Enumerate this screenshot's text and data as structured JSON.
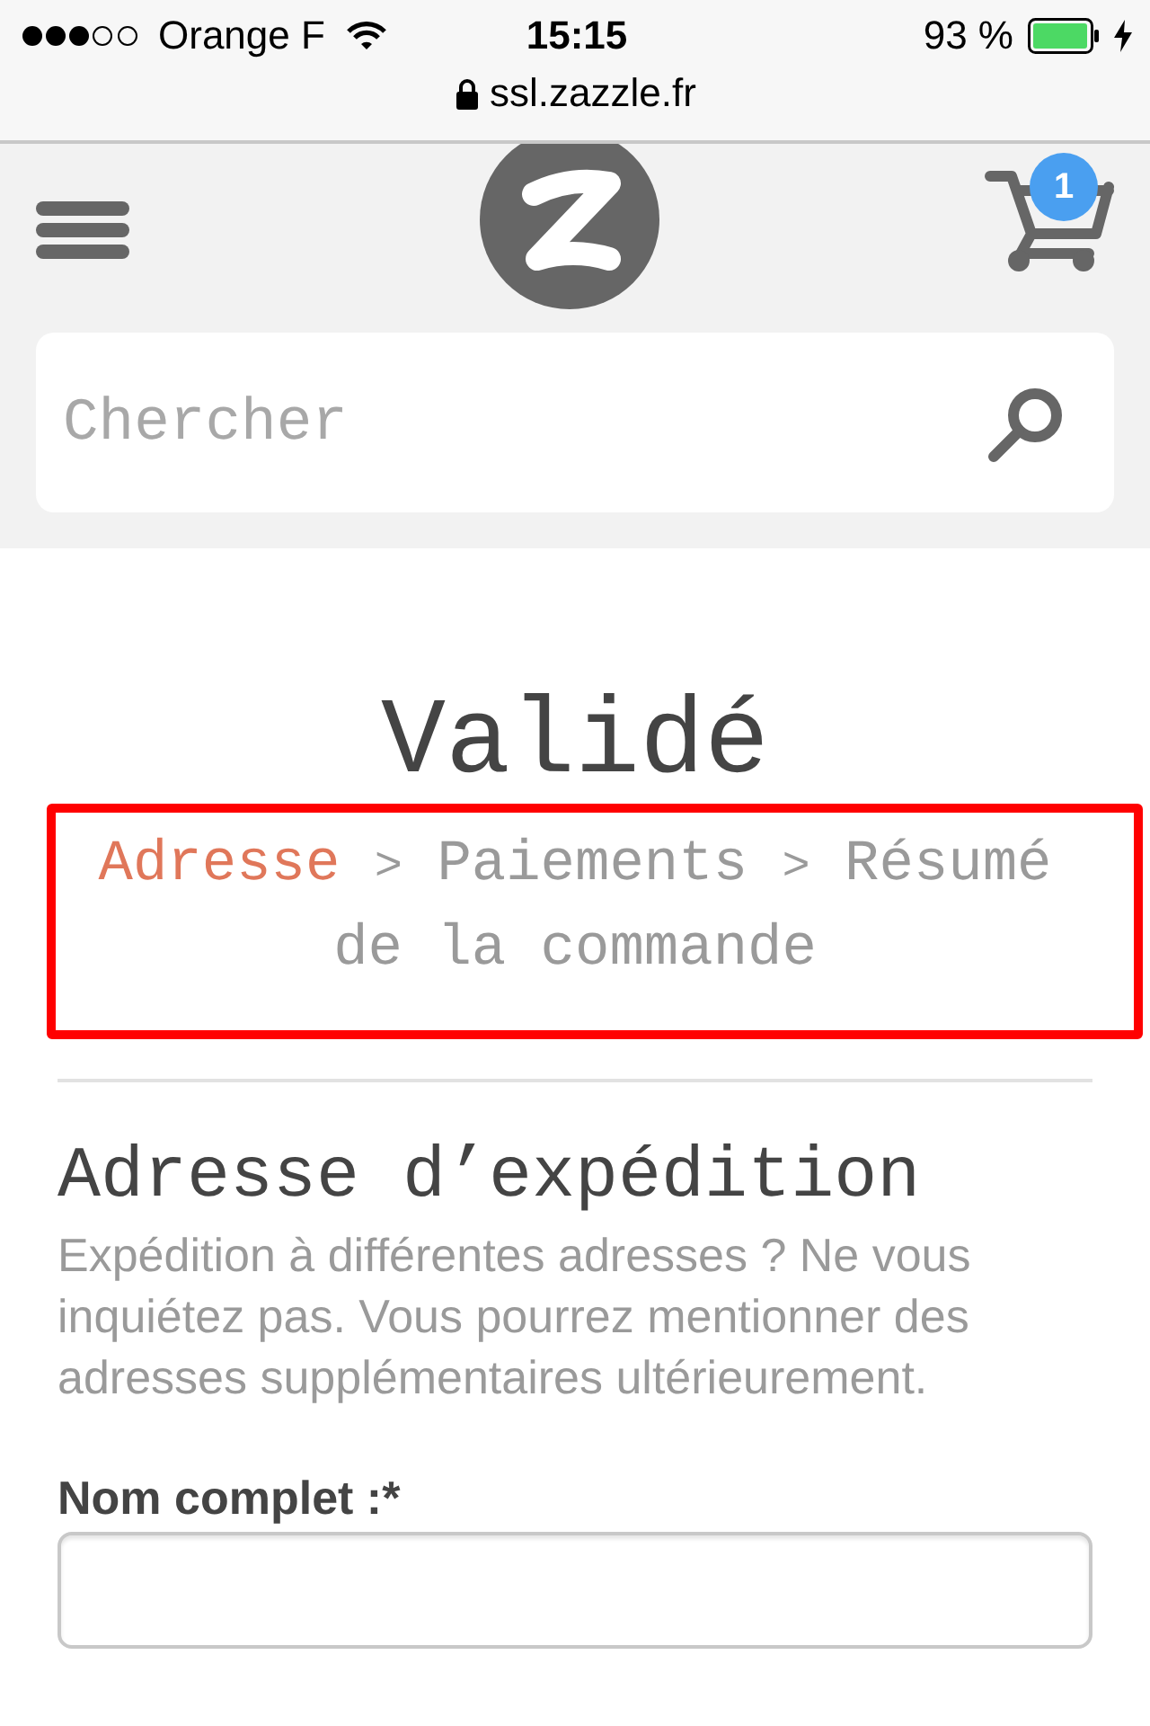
{
  "status_bar": {
    "carrier": "Orange F",
    "time": "15:15",
    "battery": "93 %"
  },
  "address_bar": {
    "url": "ssl.zazzle.fr"
  },
  "header": {
    "cart_badge": "1",
    "search": {
      "placeholder": "Chercher"
    }
  },
  "page_title": "Validé",
  "checkout_steps": [
    {
      "label": "Adresse",
      "selected": true
    },
    {
      "separator": ">",
      "label": "Paiements",
      "selected": false
    },
    {
      "separator": ">",
      "label": "Résumé de la commande",
      "selected": false
    }
  ],
  "shipping_address": {
    "title": "Adresse d’expédition",
    "note": "Expédition à différentes adresses ? Ne vous inquiétez pas. Vous pourrez mentionner des adresses supplémentaires ultérieurement.",
    "fields": [
      {
        "label": "Nom complet :*"
      }
    ]
  }
}
